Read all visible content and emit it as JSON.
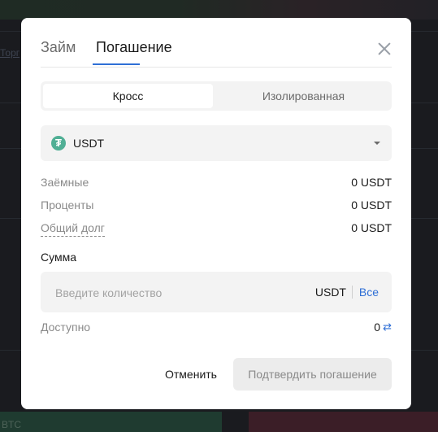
{
  "background": {
    "link_text": "Торг",
    "bottom_left_text": "BTC"
  },
  "modal": {
    "tabs": [
      {
        "label": "Займ"
      },
      {
        "label": "Погашение",
        "active": true
      }
    ],
    "mode_switch": {
      "options": [
        {
          "label": "Кросс",
          "selected": true
        },
        {
          "label": "Изолированная"
        }
      ]
    },
    "coin_select": {
      "icon": "tether-icon",
      "value": "USDT"
    },
    "details": [
      {
        "label": "Заёмные",
        "value": "0 USDT"
      },
      {
        "label": "Проценты",
        "value": "0 USDT"
      },
      {
        "label": "Общий долг",
        "value": "0 USDT"
      }
    ],
    "amount": {
      "label": "Сумма",
      "placeholder": "Введите количество",
      "unit": "USDT",
      "max_label": "Все"
    },
    "available": {
      "label": "Доступно",
      "value": "0"
    },
    "buttons": {
      "cancel": "Отменить",
      "confirm": "Подтвердить погашение"
    }
  },
  "colors": {
    "accent": "#2f6fd6",
    "tether": "#50af95"
  }
}
